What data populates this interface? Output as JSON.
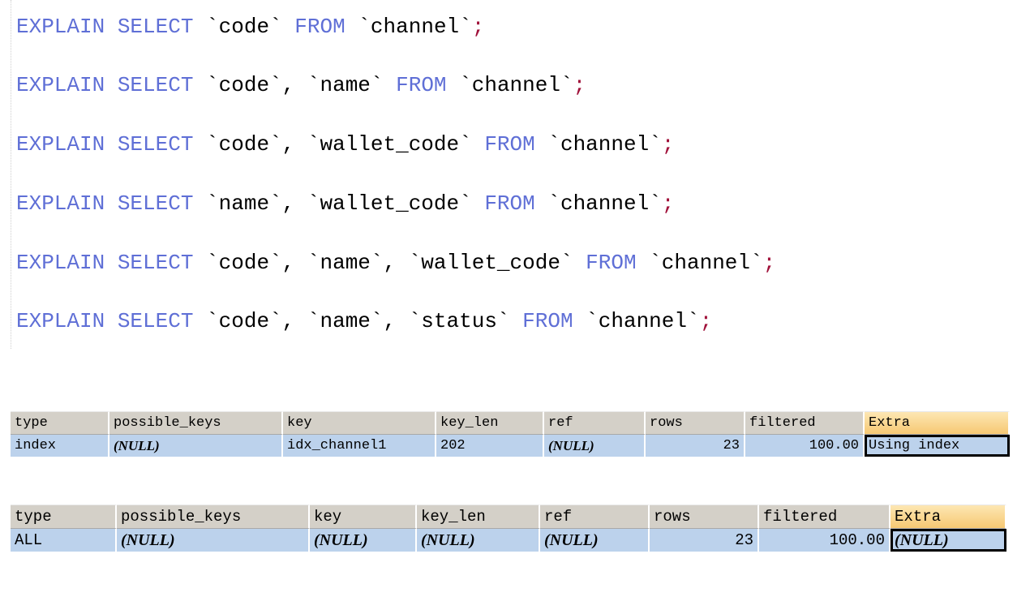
{
  "editor": {
    "lines": [
      {
        "kw1": "EXPLAIN",
        "kw2": "SELECT",
        "cols": "`code`",
        "from": "FROM",
        "table": "`channel`",
        "semi": ";"
      },
      {
        "kw1": "EXPLAIN",
        "kw2": "SELECT",
        "cols": "`code`, `name`",
        "from": "FROM",
        "table": "`channel`",
        "semi": ";"
      },
      {
        "kw1": "EXPLAIN",
        "kw2": "SELECT",
        "cols": "`code`, `wallet_code`",
        "from": "FROM",
        "table": "`channel`",
        "semi": ";"
      },
      {
        "kw1": "EXPLAIN",
        "kw2": "SELECT",
        "cols": "`name`, `wallet_code`",
        "from": "FROM",
        "table": "`channel`",
        "semi": ";"
      },
      {
        "kw1": "EXPLAIN",
        "kw2": "SELECT",
        "cols": "`code`, `name`, `wallet_code`",
        "from": "FROM",
        "table": "`channel`",
        "semi": ";"
      },
      {
        "kw1": "EXPLAIN",
        "kw2": "SELECT",
        "cols": "`code`, `name`, `status`",
        "from": "FROM",
        "table": "`channel`",
        "semi": ";"
      }
    ]
  },
  "result1": {
    "headers": [
      "type",
      "possible_keys",
      "key",
      "key_len",
      "ref",
      "rows",
      "filtered",
      "Extra"
    ],
    "row": [
      "index",
      "(NULL)",
      "idx_channel1",
      "202",
      "(NULL)",
      "23",
      "100.00",
      "Using index"
    ]
  },
  "result2": {
    "headers": [
      "type",
      "possible_keys",
      "key",
      "key_len",
      "ref",
      "rows",
      "filtered",
      "Extra"
    ],
    "row": [
      "ALL",
      "(NULL)",
      "(NULL)",
      "(NULL)",
      "(NULL)",
      "23",
      "100.00",
      "(NULL)"
    ]
  },
  "colors": {
    "keyword": "#5f6fd6",
    "punctuation": "#a0113a",
    "header_bg": "#d4d0c8",
    "extra_header_bg": "#f6c873",
    "cell_bg": "#bcd2ec"
  }
}
